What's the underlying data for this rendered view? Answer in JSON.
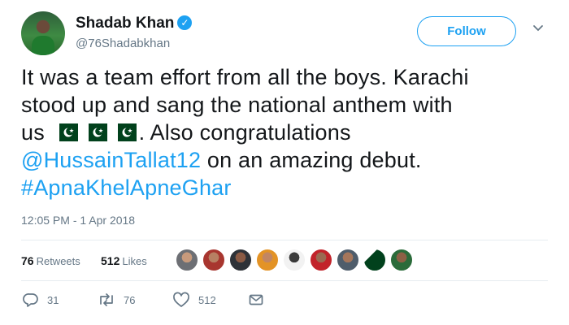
{
  "author": {
    "name": "Shadab Khan",
    "handle": "@76Shadabkhan",
    "verified_icon": "verified-badge-icon"
  },
  "follow_button": {
    "label": "Follow"
  },
  "menu": {
    "icon": "chevron-down-icon"
  },
  "tweet": {
    "line1": "It was a team effort from all the boys. Karachi",
    "line2": "stood up and sang the national anthem with",
    "line3_start": "us",
    "line3_end": ". Also congratulations",
    "mention": "@HussainTallat12",
    "line4_end": " on an amazing debut.",
    "hashtag": "#ApnaKhelApneGhar",
    "flags": [
      "pakistan-flag-icon",
      "pakistan-flag-icon",
      "pakistan-flag-icon"
    ]
  },
  "timestamp": "12:05 PM - 1 Apr 2018",
  "stats": {
    "retweets_count": "76",
    "retweets_label": "Retweets",
    "likes_count": "512",
    "likes_label": "Likes",
    "liker_avatars": [
      "avatar-1",
      "avatar-2",
      "avatar-3",
      "avatar-4",
      "avatar-5",
      "avatar-6",
      "avatar-7",
      "avatar-8",
      "avatar-9",
      "avatar-10"
    ]
  },
  "actions": {
    "reply_count": "31",
    "retweet_count": "76",
    "like_count": "512"
  },
  "colors": {
    "accent": "#1da1f2",
    "text": "#14171a",
    "muted": "#657786",
    "divider": "#e6ecf0",
    "flag_green": "#01411c"
  }
}
